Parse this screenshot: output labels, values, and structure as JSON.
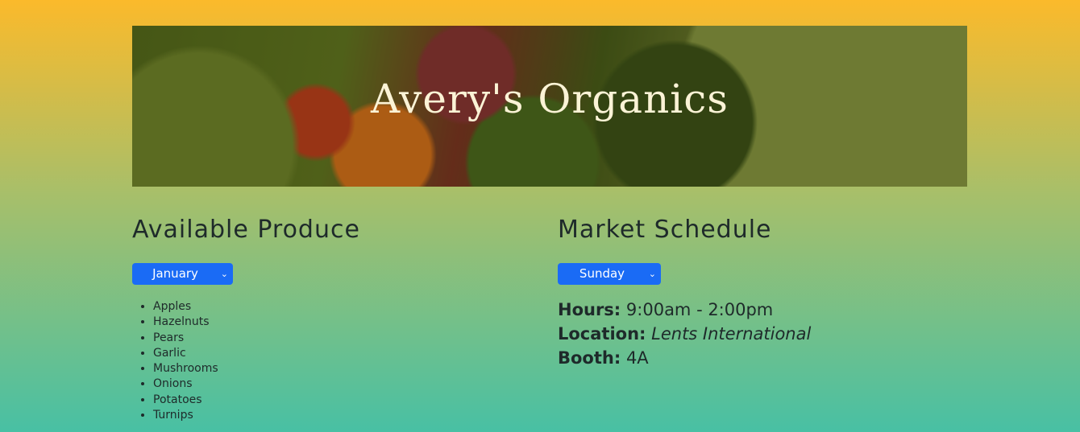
{
  "banner": {
    "title": "Avery's Organics"
  },
  "produce": {
    "title": "Available Produce",
    "month_select": "January",
    "items": [
      "Apples",
      "Hazelnuts",
      "Pears",
      "Garlic",
      "Mushrooms",
      "Onions",
      "Potatoes",
      "Turnips"
    ]
  },
  "schedule": {
    "title": "Market Schedule",
    "day_select": "Sunday",
    "hours_label": "Hours:",
    "hours_value": "9:00am - 2:00pm",
    "location_label": "Location:",
    "location_value": "Lents International",
    "booth_label": "Booth:",
    "booth_value": "4A"
  },
  "colors": {
    "select_bg": "#1a6bf5",
    "title_text": "#fbf3d6"
  }
}
